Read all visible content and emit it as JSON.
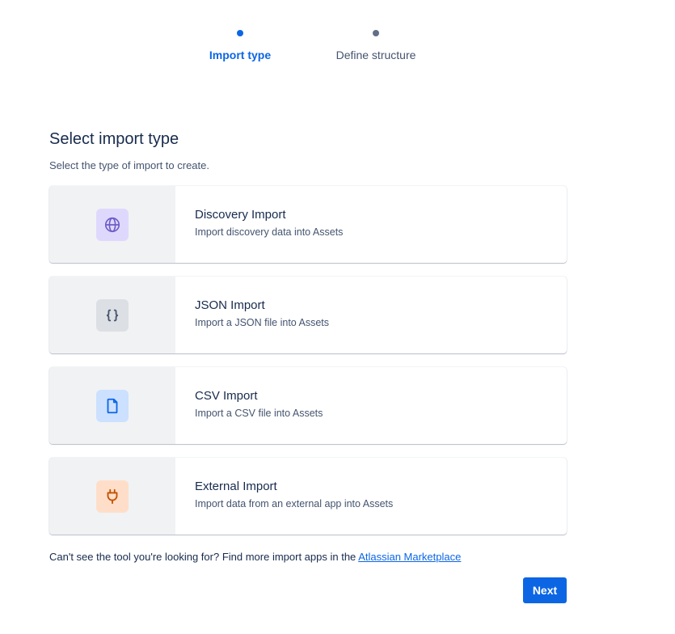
{
  "stepper": {
    "steps": [
      {
        "label": "Import type",
        "active": true
      },
      {
        "label": "Define structure",
        "active": false
      }
    ]
  },
  "header": {
    "title": "Select import type",
    "subtitle": "Select the type of import to create."
  },
  "cards": [
    {
      "title": "Discovery Import",
      "description": "Import discovery data into Assets",
      "icon": "globe-icon",
      "color": "#dfd8fd"
    },
    {
      "title": "JSON Import",
      "description": "Import a JSON file into Assets",
      "icon": "curly-braces-icon",
      "color": "#dcdfe4"
    },
    {
      "title": "CSV Import",
      "description": "Import a CSV file into Assets",
      "icon": "file-icon",
      "color": "#cce0ff"
    },
    {
      "title": "External Import",
      "description": "Import data from an external app into Assets",
      "icon": "plug-icon",
      "color": "#fedec8"
    }
  ],
  "footer": {
    "text": "Can't see the tool you're looking for? Find more import apps in the ",
    "link_label": "Atlassian Marketplace"
  },
  "actions": {
    "next_label": "Next"
  },
  "colors": {
    "primary": "#0c66e4",
    "text": "#172b4d",
    "subtle_text": "#44546f"
  }
}
